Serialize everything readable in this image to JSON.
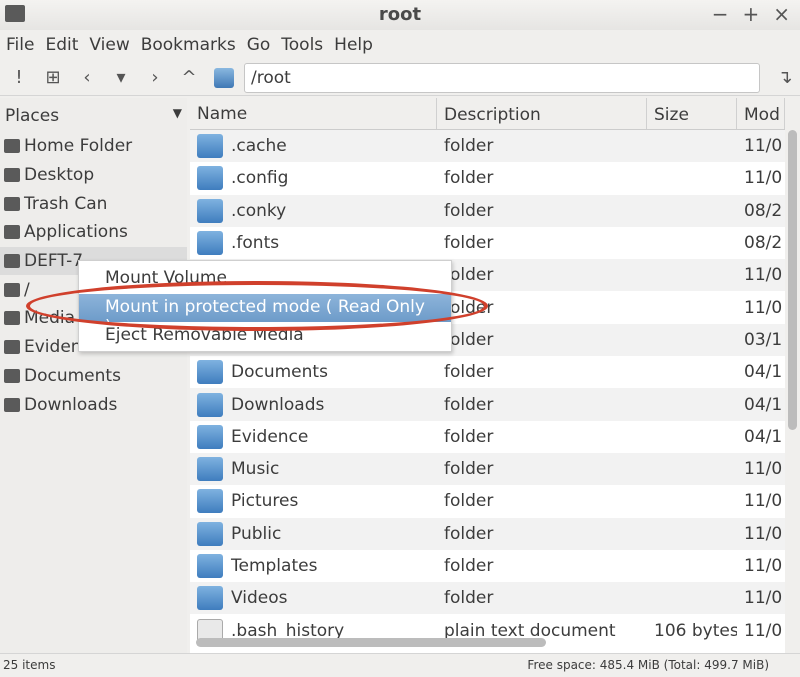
{
  "window": {
    "title": "root"
  },
  "menubar": [
    "File",
    "Edit",
    "View",
    "Bookmarks",
    "Go",
    "Tools",
    "Help"
  ],
  "toolbar": {
    "path": "/root"
  },
  "sidebar": {
    "header": "Places",
    "items": [
      "Home Folder",
      "Desktop",
      "Trash Can",
      "Applications",
      "DEFT-7",
      "/",
      "Media",
      "Evidence",
      "Documents",
      "Downloads"
    ]
  },
  "columns": [
    "Name",
    "Description",
    "Size",
    "Mod"
  ],
  "files": [
    {
      "name": ".cache",
      "desc": "folder",
      "size": "",
      "mod": "11/0",
      "icon": "folder-icon"
    },
    {
      "name": ".config",
      "desc": "folder",
      "size": "",
      "mod": "11/0",
      "icon": "folder-icon"
    },
    {
      "name": ".conky",
      "desc": "folder",
      "size": "",
      "mod": "08/2",
      "icon": "folder-icon"
    },
    {
      "name": ".fonts",
      "desc": "folder",
      "size": "",
      "mod": "08/2",
      "icon": "folder-icon"
    },
    {
      "name": "",
      "desc": "folder",
      "size": "",
      "mod": "11/0",
      "icon": "folder-icon"
    },
    {
      "name": "",
      "desc": "folder",
      "size": "",
      "mod": "11/0",
      "icon": "folder-icon"
    },
    {
      "name": "",
      "desc": "folder",
      "size": "",
      "mod": "03/1",
      "icon": "folder-icon"
    },
    {
      "name": "Documents",
      "desc": "folder",
      "size": "",
      "mod": "04/1",
      "icon": "documents-folder-icon"
    },
    {
      "name": "Downloads",
      "desc": "folder",
      "size": "",
      "mod": "04/1",
      "icon": "downloads-folder-icon"
    },
    {
      "name": "Evidence",
      "desc": "folder",
      "size": "",
      "mod": "04/1",
      "icon": "folder-icon"
    },
    {
      "name": "Music",
      "desc": "folder",
      "size": "",
      "mod": "11/0",
      "icon": "music-folder-icon"
    },
    {
      "name": "Pictures",
      "desc": "folder",
      "size": "",
      "mod": "11/0",
      "icon": "pictures-folder-icon"
    },
    {
      "name": "Public",
      "desc": "folder",
      "size": "",
      "mod": "11/0",
      "icon": "public-folder-icon"
    },
    {
      "name": "Templates",
      "desc": "folder",
      "size": "",
      "mod": "11/0",
      "icon": "templates-folder-icon"
    },
    {
      "name": "Videos",
      "desc": "folder",
      "size": "",
      "mod": "11/0",
      "icon": "videos-folder-icon"
    },
    {
      "name": ".bash_history",
      "desc": "plain text document",
      "size": "106 bytes",
      "mod": "11/0",
      "icon": "text-file-icon"
    }
  ],
  "context_menu": [
    "Mount Volume",
    "Mount in protected mode ( Read Only )",
    "Eject Removable Media"
  ],
  "status": {
    "items": "25 items",
    "free": "Free space: 485.4 MiB (Total: 499.7 MiB)"
  },
  "colors": {
    "highlight": "#7aa6d2",
    "annotation_ring": "#d0402c",
    "folder": "#4f8cc9"
  }
}
